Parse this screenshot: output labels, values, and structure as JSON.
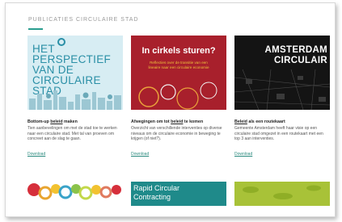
{
  "section_title": "Publicaties circulaire stad",
  "cards": [
    {
      "thumb_title_lines": [
        "HET",
        "PERSPECTIEF",
        "VAN DE",
        "CIRCULAIRE STAD"
      ],
      "heading_pre": "Bottom-up ",
      "heading_link": "beleid",
      "heading_post": " maken",
      "body": "Tien aanbevelingen om met de stad toe te werken naar een circulaire stad. Met tal van proeven om concreet aan de slag te gaan.",
      "download": "Download"
    },
    {
      "thumb_title": "In cirkels sturen?",
      "thumb_subtitle": "Reflecties over de transitie van een lineaire naar een circulaire economie",
      "heading_pre": "Afwegingen om tot ",
      "heading_link": "beleid",
      "heading_post": " te komen",
      "body": "Overzicht van verschillende interventies op diverse niveaus om de circulaire economie in beweging te krijgen (of niet?).",
      "download": "Download"
    },
    {
      "thumb_title_lines": [
        "AMSTERDAM",
        "CIRCULAIR"
      ],
      "heading_pre": "",
      "heading_link": "Beleid",
      "heading_post": " als een routekaart",
      "body": "Gemeente Amsterdam heeft haar visie op een circulaire stad omgezet in een routekaart met een top 3 aan interventies.",
      "download": "Download"
    }
  ],
  "bottom_row": {
    "middle_title_lines": [
      "Rapid Circular",
      "Contracting"
    ]
  },
  "colors": {
    "accent": "#2a9d8f",
    "card1_bg": "#d7edf3",
    "card2_bg": "#a8202c",
    "card3_bg": "#141414",
    "bottom2_bg": "#1f8a8a",
    "bottom3_bg": "#a8c238"
  }
}
